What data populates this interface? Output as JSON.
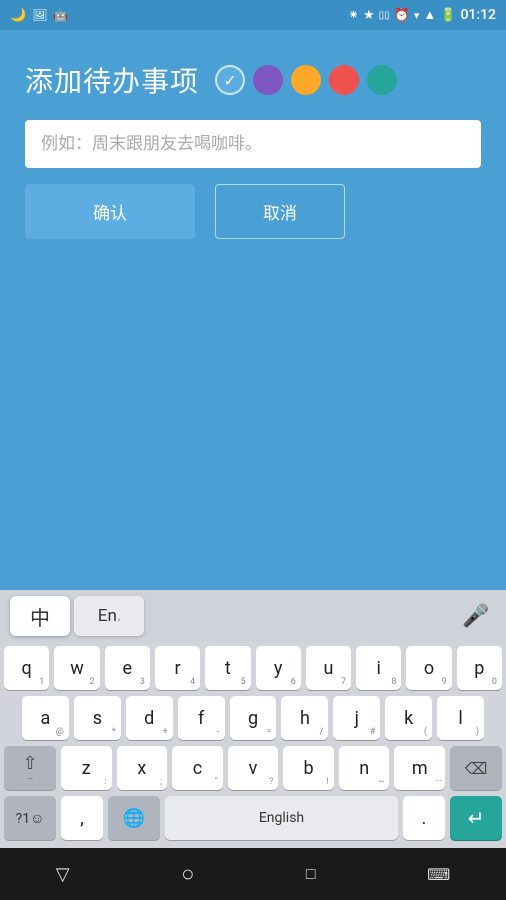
{
  "statusBar": {
    "time": "01:12",
    "leftIcons": [
      "moon-icon",
      "image-icon",
      "android-icon"
    ],
    "rightIcons": [
      "bluetooth-icon",
      "star-icon",
      "vibrate-icon",
      "alarm-icon",
      "wifi-icon",
      "signal-icon",
      "battery-icon"
    ]
  },
  "app": {
    "title": "添加待办事项",
    "colorDots": [
      {
        "id": "check",
        "color": "#5bc8f5"
      },
      {
        "id": "purple",
        "color": "#7e57c2"
      },
      {
        "id": "orange",
        "color": "#ffa726"
      },
      {
        "id": "pink",
        "color": "#ef5350"
      },
      {
        "id": "green",
        "color": "#26a69a"
      }
    ],
    "inputPlaceholder": "例如：周末跟朋友去喝咖啡。",
    "confirmLabel": "确认",
    "cancelLabel": "取消"
  },
  "keyboard": {
    "langZh": "中",
    "langEn": "En",
    "micIcon": "mic-icon",
    "rows": [
      {
        "keys": [
          {
            "main": "q",
            "sub": "1"
          },
          {
            "main": "w",
            "sub": "2"
          },
          {
            "main": "e",
            "sub": "3"
          },
          {
            "main": "r",
            "sub": "4"
          },
          {
            "main": "t",
            "sub": "5"
          },
          {
            "main": "y",
            "sub": "6"
          },
          {
            "main": "u",
            "sub": "7"
          },
          {
            "main": "i",
            "sub": "8"
          },
          {
            "main": "o",
            "sub": "9"
          },
          {
            "main": "p",
            "sub": "0"
          }
        ]
      },
      {
        "keys": [
          {
            "main": "a",
            "sub": "@"
          },
          {
            "main": "s",
            "sub": "*"
          },
          {
            "main": "d",
            "sub": "+"
          },
          {
            "main": "f",
            "sub": "-"
          },
          {
            "main": "g",
            "sub": "="
          },
          {
            "main": "h",
            "sub": "/"
          },
          {
            "main": "j",
            "sub": "#"
          },
          {
            "main": "k",
            "sub": "("
          },
          {
            "main": "l",
            "sub": ")"
          }
        ]
      },
      {
        "keys": [
          {
            "main": "z",
            "sub": ":"
          },
          {
            "main": "x",
            "sub": ";"
          },
          {
            "main": "c",
            "sub": "\""
          },
          {
            "main": "v",
            "sub": "?"
          },
          {
            "main": "b",
            "sub": "!"
          },
          {
            "main": "n",
            "sub": "~"
          },
          {
            "main": "m",
            "sub": "..."
          }
        ]
      }
    ],
    "bottomRow": {
      "symLabel": "?1☺",
      "comma": ",",
      "globeIcon": "globe-icon",
      "spaceLabel": "English",
      "period": ".",
      "enterIcon": "enter-icon"
    }
  },
  "navBar": {
    "backIcon": "back-triangle-icon",
    "homeIcon": "home-circle-icon",
    "recentIcon": "recent-square-icon",
    "keyboardIcon": "keyboard-icon"
  }
}
